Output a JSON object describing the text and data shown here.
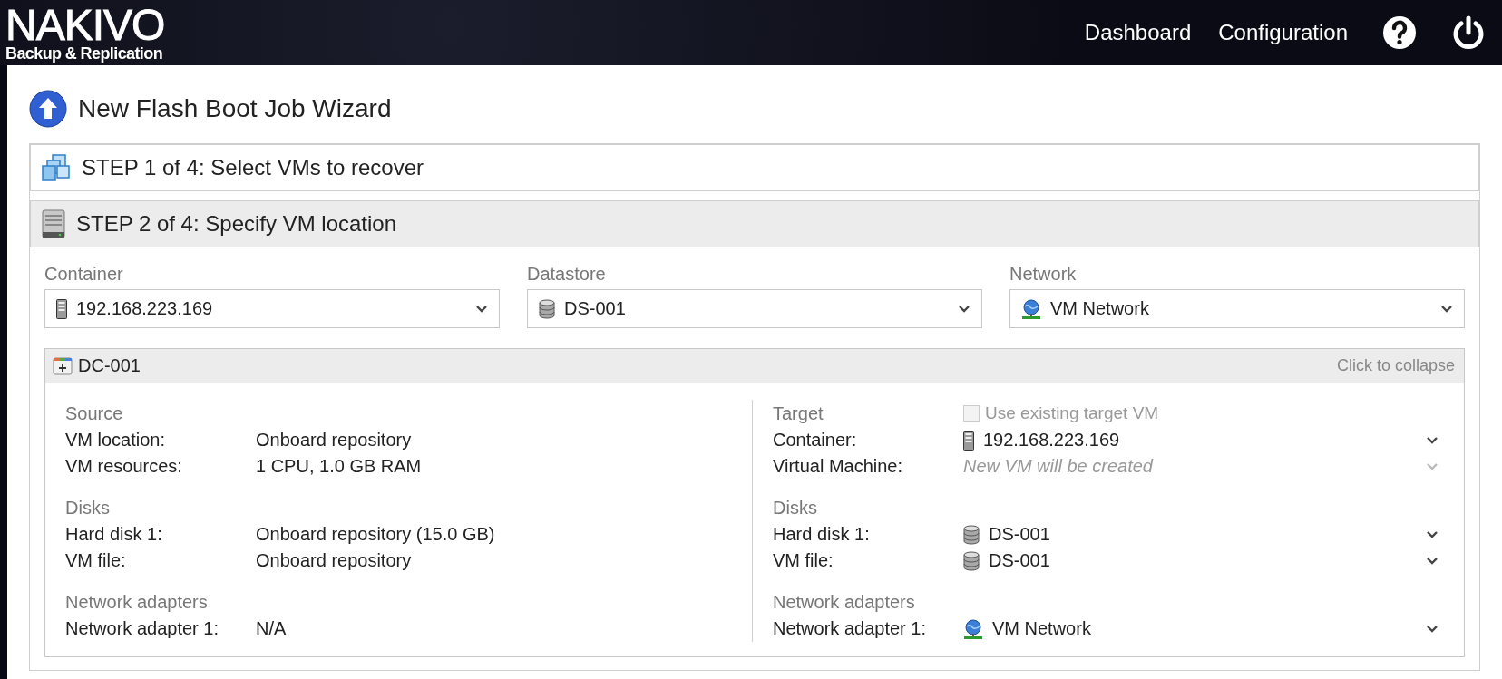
{
  "header": {
    "logo": {
      "name": "NAKIVO",
      "tagline": "Backup & Replication"
    },
    "nav": [
      {
        "label": "Dashboard"
      },
      {
        "label": "Configuration"
      }
    ]
  },
  "wizard": {
    "title": "New Flash Boot Job Wizard",
    "steps": [
      {
        "label": "STEP 1 of 4: Select VMs to recover",
        "kind": "vms",
        "expanded": false
      },
      {
        "label": "STEP 2 of 4: Specify VM location",
        "kind": "storage",
        "expanded": true
      }
    ],
    "selectors": [
      {
        "label": "Container",
        "value": "192.168.223.169",
        "kind": "server"
      },
      {
        "label": "Datastore",
        "value": "DS-001",
        "kind": "datastore"
      },
      {
        "label": "Network",
        "value": "VM Network",
        "kind": "network"
      }
    ],
    "vm_group": {
      "name": "DC-001",
      "collapse_hint": "Click to collapse",
      "source": {
        "title": "Source",
        "sections": [
          {
            "rows": [
              {
                "label": "VM location:",
                "value": "Onboard repository"
              },
              {
                "label": "VM resources:",
                "value": "1 CPU, 1.0 GB RAM"
              }
            ]
          },
          {
            "title": "Disks",
            "rows": [
              {
                "label": "Hard disk 1:",
                "value": "Onboard repository (15.0 GB)"
              },
              {
                "label": "VM file:",
                "value": "Onboard repository"
              }
            ]
          },
          {
            "title": "Network adapters",
            "rows": [
              {
                "label": "Network adapter 1:",
                "value": "N/A"
              }
            ]
          }
        ]
      },
      "target": {
        "title": "Target",
        "use_existing": {
          "label": "Use existing target VM",
          "checked": false,
          "disabled": true
        },
        "sections": [
          {
            "rows": [
              {
                "label": "Container:",
                "value": "192.168.223.169",
                "kind": "server",
                "disabled": false
              },
              {
                "label": "Virtual Machine:",
                "placeholder": "New VM will be created",
                "kind": "none",
                "disabled": true
              }
            ]
          },
          {
            "title": "Disks",
            "rows": [
              {
                "label": "Hard disk 1:",
                "value": "DS-001",
                "kind": "datastore",
                "disabled": false
              },
              {
                "label": "VM file:",
                "value": "DS-001",
                "kind": "datastore",
                "disabled": false
              }
            ]
          },
          {
            "title": "Network adapters",
            "rows": [
              {
                "label": "Network adapter 1:",
                "value": "VM Network",
                "kind": "network",
                "disabled": false
              }
            ]
          }
        ]
      }
    }
  }
}
